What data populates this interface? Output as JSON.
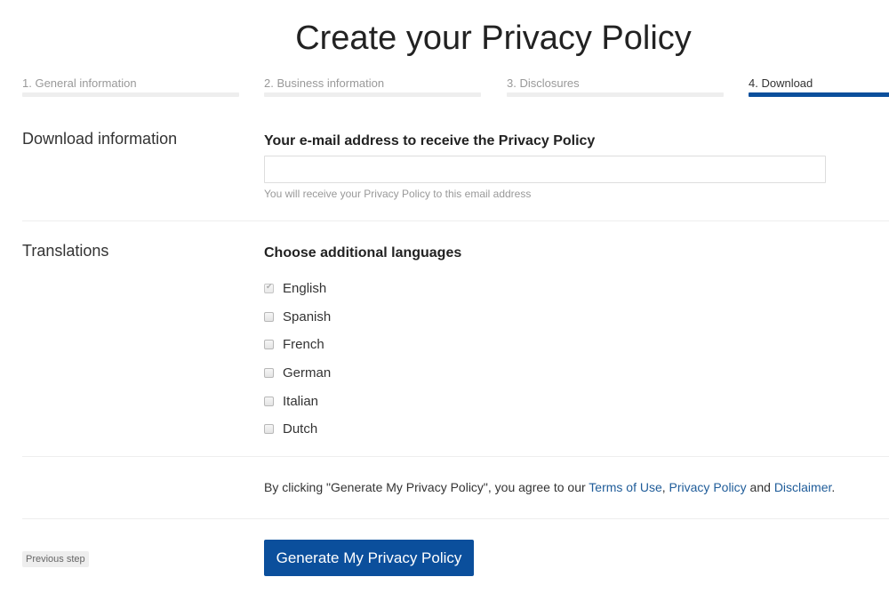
{
  "page": {
    "title": "Create your Privacy Policy"
  },
  "steps": [
    {
      "label": "1. General information",
      "active": false
    },
    {
      "label": "2. Business information",
      "active": false
    },
    {
      "label": "3. Disclosures",
      "active": false
    },
    {
      "label": "4. Download",
      "active": true
    }
  ],
  "download_section": {
    "label": "Download information",
    "email_label": "Your e-mail address to receive the Privacy Policy",
    "email_value": "",
    "email_placeholder": "",
    "help_text": "You will receive your Privacy Policy to this email address"
  },
  "translations_section": {
    "label": "Translations",
    "languages_label": "Choose additional languages",
    "languages": [
      {
        "label": "English",
        "checked": true,
        "disabled": true
      },
      {
        "label": "Spanish",
        "checked": false,
        "disabled": false
      },
      {
        "label": "French",
        "checked": false,
        "disabled": false
      },
      {
        "label": "German",
        "checked": false,
        "disabled": false
      },
      {
        "label": "Italian",
        "checked": false,
        "disabled": false
      },
      {
        "label": "Dutch",
        "checked": false,
        "disabled": false
      }
    ]
  },
  "agreement": {
    "prefix": "By clicking \"Generate My Privacy Policy\", you agree to our ",
    "terms_link": "Terms of Use",
    "comma": ", ",
    "privacy_link": "Privacy Policy",
    "and": " and ",
    "disclaimer_link": "Disclaimer",
    "suffix": "."
  },
  "actions": {
    "previous_label": "Previous step",
    "generate_label": "Generate My Privacy Policy"
  },
  "colors": {
    "accent": "#0b4f9c",
    "link": "#1f5c99",
    "inactive_step_bar": "#eeeeee"
  }
}
